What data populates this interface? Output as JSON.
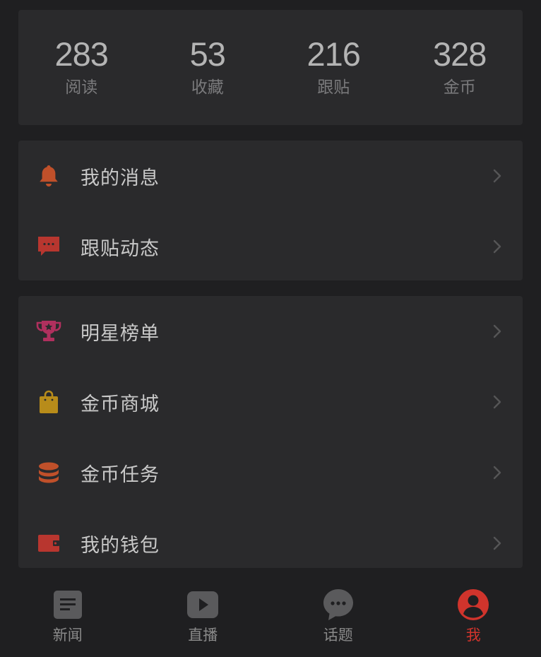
{
  "stats": [
    {
      "value": "283",
      "label": "阅读"
    },
    {
      "value": "53",
      "label": "收藏"
    },
    {
      "value": "216",
      "label": "跟贴"
    },
    {
      "value": "328",
      "label": "金币"
    }
  ],
  "menu_group_1": [
    {
      "label": "我的消息",
      "icon": "bell-icon",
      "color": "#c0502a"
    },
    {
      "label": "跟贴动态",
      "icon": "comment-icon",
      "color": "#b8362f"
    }
  ],
  "menu_group_2": [
    {
      "label": "明星榜单",
      "icon": "trophy-icon",
      "color": "#b0305e"
    },
    {
      "label": "金币商城",
      "icon": "shopping-bag-icon",
      "color": "#b88c1a"
    },
    {
      "label": "金币任务",
      "icon": "coin-stack-icon",
      "color": "#c0502a"
    },
    {
      "label": "我的钱包",
      "icon": "wallet-icon",
      "color": "#b8362f"
    }
  ],
  "tabbar": {
    "items": [
      {
        "label": "新闻",
        "icon": "news-icon",
        "active": false
      },
      {
        "label": "直播",
        "icon": "play-icon",
        "active": false
      },
      {
        "label": "话题",
        "icon": "chat-bubble-icon",
        "active": false
      },
      {
        "label": "我",
        "icon": "user-icon",
        "active": true
      }
    ],
    "active_color": "#d0342c",
    "inactive_color": "#5a5a5c"
  }
}
